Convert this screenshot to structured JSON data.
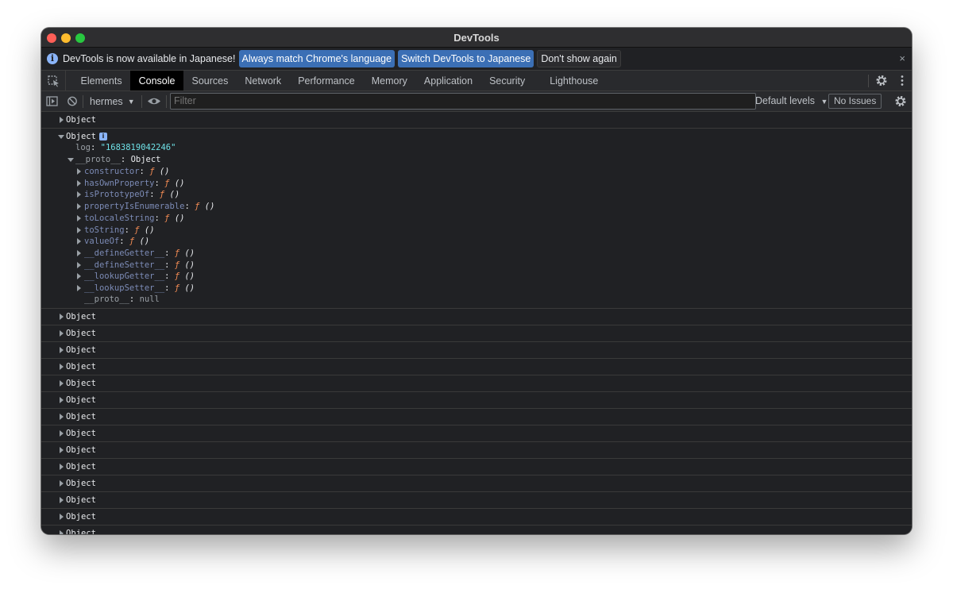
{
  "window": {
    "title": "DevTools"
  },
  "infobar": {
    "message": "DevTools is now available in Japanese!",
    "btn_match": "Always match Chrome's language",
    "btn_switch": "Switch DevTools to Japanese",
    "btn_dismiss": "Don't show again",
    "close": "×"
  },
  "tabs": [
    "Elements",
    "Console",
    "Sources",
    "Network",
    "Performance",
    "Memory",
    "Application",
    "Security",
    "Lighthouse"
  ],
  "toolbar": {
    "context": "hermes",
    "filter_placeholder": "Filter",
    "levels": "Default levels",
    "issues": "No Issues"
  },
  "console": {
    "top_item": "Object",
    "expanded": {
      "label": "Object",
      "info_badge": "i",
      "log_key": "log",
      "log_value": "\"1683819042246\"",
      "proto_key": "__proto__",
      "proto_value": "Object",
      "functions": [
        "constructor",
        "hasOwnProperty",
        "isPrototypeOf",
        "propertyIsEnumerable",
        "toLocaleString",
        "toString",
        "valueOf",
        "__defineGetter__",
        "__defineSetter__",
        "__lookupGetter__",
        "__lookupSetter__"
      ],
      "fn_symbol": "ƒ",
      "fn_parens": "()",
      "inner_proto_key": "__proto__",
      "inner_proto_value": "null"
    },
    "items": [
      "Object",
      "Object",
      "Object",
      "Object",
      "Object",
      "Object",
      "Object",
      "Object",
      "Object",
      "Object",
      "Object",
      "Object",
      "Object",
      "Object"
    ]
  },
  "colors": {
    "background": "#202124",
    "accent": "#3b6fb5",
    "string": "#6ee0e6",
    "function": "#f28b54"
  }
}
